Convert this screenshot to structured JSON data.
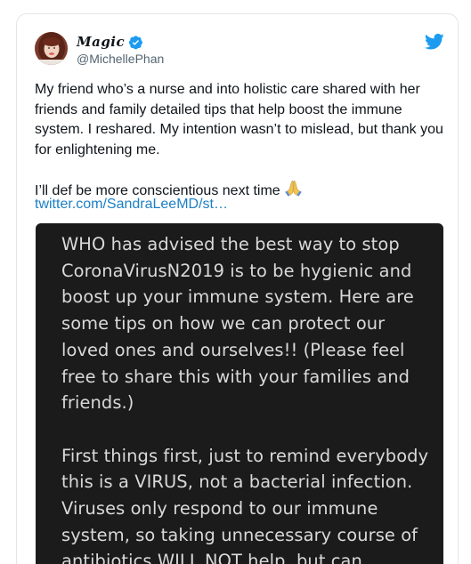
{
  "author": {
    "display_name": "Magic",
    "handle": "@MichellePhan"
  },
  "icons": {
    "verified": "verified-badge-icon",
    "brand": "twitter-bird-icon",
    "emoji": "folded-hands-emoji"
  },
  "colors": {
    "brand_blue": "#1d9bf0",
    "link": "#1b7fc4",
    "media_bg": "#1b1b1c"
  },
  "tweet": {
    "paragraph1": "My friend who’s a nurse and into holistic care shared with her friends and family detailed tips that help boost the immune system. I reshared. My intention wasn’t to mislead, but thank you for enlightening me.",
    "paragraph2": "I’ll def be more conscientious next time",
    "emoji": "🙏",
    "link": "twitter.com/SandraLeeMD/st…"
  },
  "media": {
    "paragraph1": "WHO has advised the best way to stop CoronaVirusN2019 is to be hygienic and boost up your immune system. Here are some tips on how we can protect our loved ones and ourselves!! (Please feel free to share this with your families and friends.)",
    "paragraph2": "First things first, just to remind everybody this is a VIRUS, not a bacterial infection. Viruses only respond to our immune system, so taking unnecessary course of antibiotics WILL NOT help, but can"
  }
}
